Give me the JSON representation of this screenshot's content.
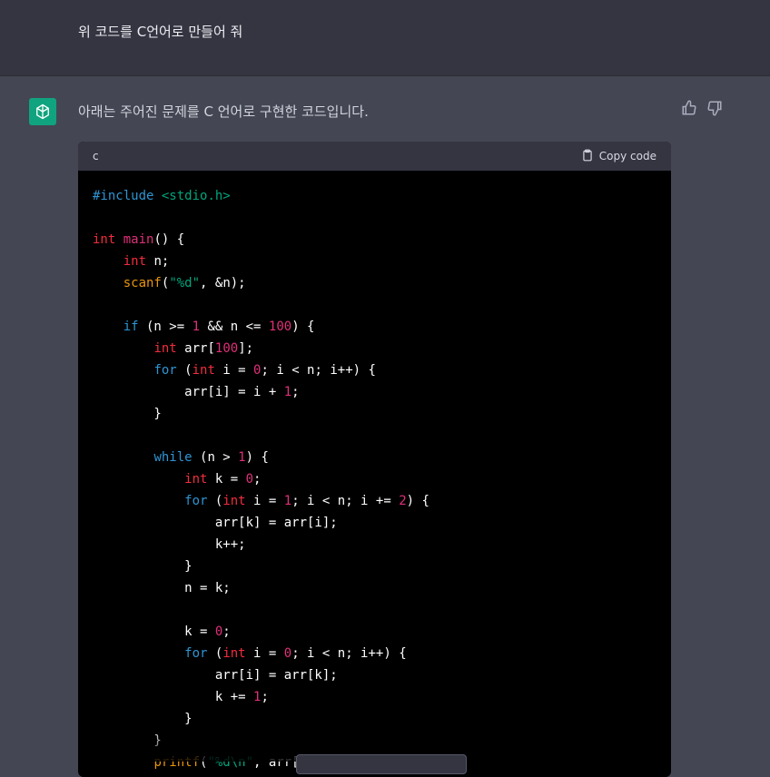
{
  "user": {
    "message": "위 코드를 C언어로 만들어 줘"
  },
  "assistant": {
    "avatar_icon": "openai-logo-icon",
    "message": "아래는 주어진 문제를 C 언어로 구현한 코드입니다.",
    "feedback": {
      "thumbs_up_icon": "thumbs-up-icon",
      "thumbs_down_icon": "thumbs-down-icon"
    },
    "code_block": {
      "language": "c",
      "copy_label": "Copy code",
      "lines": [
        "#include <stdio.h>",
        "",
        "int main() {",
        "    int n;",
        "    scanf(\"%d\", &n);",
        "",
        "    if (n >= 1 && n <= 100) {",
        "        int arr[100];",
        "        for (int i = 0; i < n; i++) {",
        "            arr[i] = i + 1;",
        "        }",
        "",
        "        while (n > 1) {",
        "            int k = 0;",
        "            for (int i = 1; i < n; i += 2) {",
        "                arr[k] = arr[i];",
        "                k++;",
        "            }",
        "            n = k;",
        "",
        "            k = 0;",
        "            for (int i = 0; i < n; i++) {",
        "                arr[i] = arr[k];",
        "                k += 1;",
        "            }",
        "        }",
        "        printf(\"%d\\n\", arr["
      ]
    }
  },
  "colors": {
    "user_bg": "#343541",
    "assistant_bg": "#444654",
    "code_bg": "#000000",
    "avatar_bg": "#10a37f"
  }
}
